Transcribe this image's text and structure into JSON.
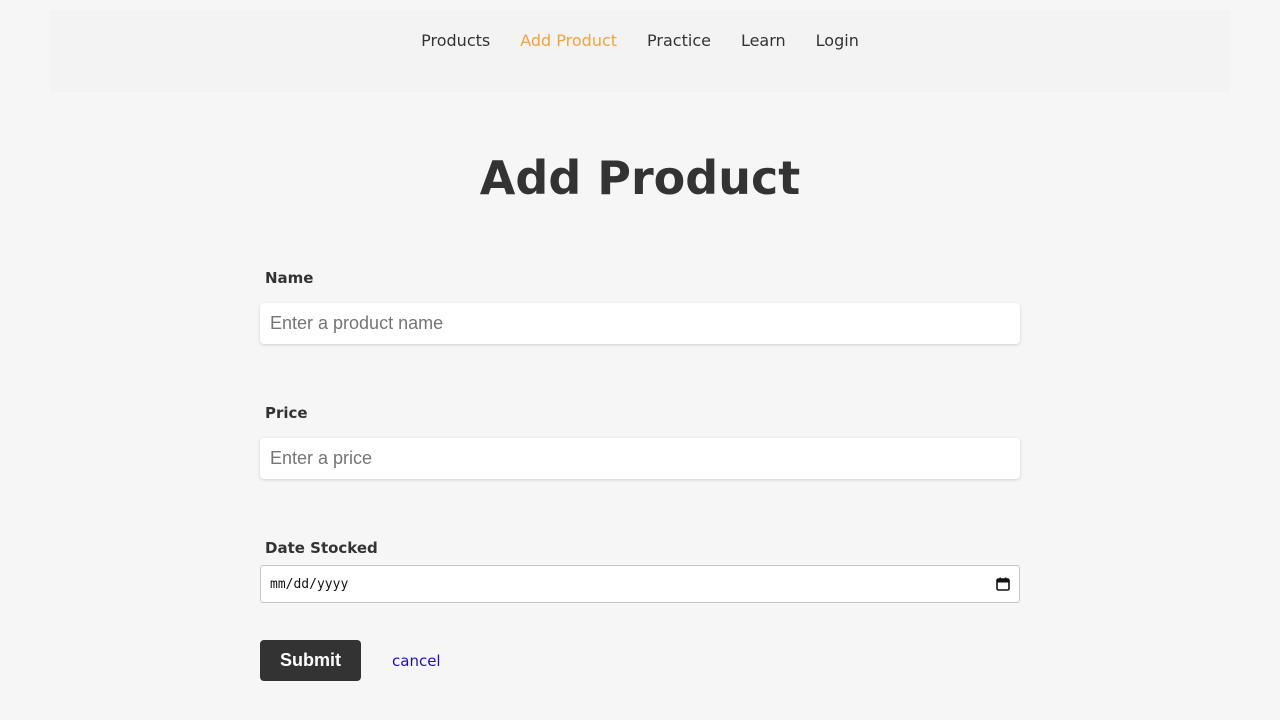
{
  "nav": {
    "items": [
      {
        "label": "Products",
        "active": false
      },
      {
        "label": "Add Product",
        "active": true
      },
      {
        "label": "Practice",
        "active": false
      },
      {
        "label": "Learn",
        "active": false
      },
      {
        "label": "Login",
        "active": false
      }
    ],
    "active_color": "#f2a43a"
  },
  "page": {
    "title": "Add Product"
  },
  "form": {
    "name": {
      "label": "Name",
      "value": "",
      "placeholder": "Enter a product name"
    },
    "price": {
      "label": "Price",
      "value": "",
      "placeholder": "Enter a price"
    },
    "date_stocked": {
      "label": "Date Stocked",
      "display": "mm/dd/yyyy",
      "icon": "calendar-icon"
    },
    "submit_label": "Submit",
    "cancel_label": "cancel"
  }
}
